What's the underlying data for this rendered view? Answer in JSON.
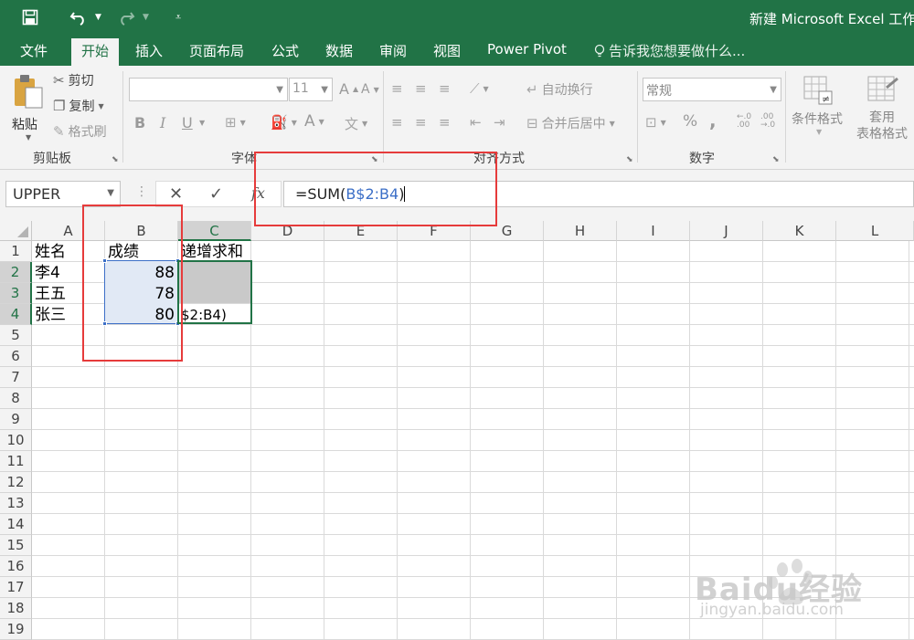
{
  "colors": {
    "excel_green": "#217346",
    "ribbon_bg": "#f3f3f3",
    "selection_blue": "#3c6fc7",
    "highlight_red": "#e63b3b"
  },
  "title": "新建 Microsoft Excel 工作",
  "quick_access": {
    "save_icon": "save-icon",
    "undo_icon": "undo-icon",
    "redo_icon": "redo-icon",
    "customize_icon": "customize-icon"
  },
  "tabs": [
    "文件",
    "开始",
    "插入",
    "页面布局",
    "公式",
    "数据",
    "审阅",
    "视图",
    "Power Pivot"
  ],
  "active_tab": "开始",
  "tell_me": "告诉我您想要做什么...",
  "ribbon": {
    "clipboard": {
      "paste": "粘贴",
      "cut": "剪切",
      "copy": "复制",
      "format_painter": "格式刷",
      "label": "剪贴板"
    },
    "font": {
      "font_name": "",
      "font_size": "11",
      "label": "字体",
      "grow": "A",
      "shrink": "A",
      "bold": "B",
      "italic": "I",
      "underline": "U",
      "font_color": "A"
    },
    "alignment": {
      "wrap_text": "自动换行",
      "merge_center": "合并后居中",
      "label": "对齐方式"
    },
    "number": {
      "format": "常规",
      "percent": "%",
      "comma": ",",
      "label": "数字",
      "inc_decimal": "←.0\n.00",
      "dec_decimal": ".00\n→.0"
    },
    "styles": {
      "conditional_formatting": "条件格式",
      "format_as_table": "套用\n表格格式"
    }
  },
  "formula_bar": {
    "name_box": "UPPER",
    "fx": "fx",
    "formula_prefix": "=SUM(",
    "formula_ref": "B$2:B4",
    "formula_suffix": ")"
  },
  "sheet": {
    "columns": [
      "A",
      "B",
      "C",
      "D",
      "E",
      "F",
      "G",
      "H",
      "I",
      "J",
      "K",
      "L"
    ],
    "rows": [
      "1",
      "2",
      "3",
      "4",
      "5",
      "6",
      "7",
      "8",
      "9",
      "10",
      "11",
      "12",
      "13",
      "14",
      "15",
      "16",
      "17",
      "18",
      "19"
    ],
    "cells": {
      "A1": "姓名",
      "B1": "成绩",
      "C1": "递增求和",
      "A2": "李4",
      "B2": "88",
      "A3": "王五",
      "B3": "78",
      "A4": "张三",
      "B4": "80",
      "C4": "$2:B4)"
    }
  },
  "watermark": {
    "brand": "Baidu经验",
    "url": "jingyan.baidu.com"
  }
}
